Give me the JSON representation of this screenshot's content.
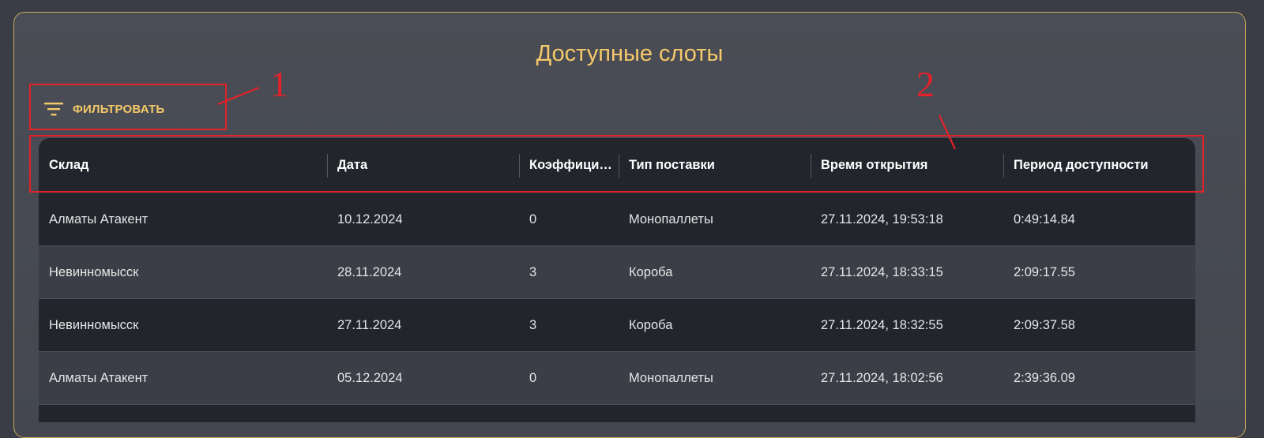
{
  "page": {
    "title": "Доступные слоты",
    "accent_color": "#f5c96a",
    "border_color": "#c9a85a"
  },
  "filter": {
    "icon": "filter-list-icon",
    "label": "ФИЛЬТРОВАТЬ"
  },
  "table": {
    "columns": [
      "Склад",
      "Дата",
      "Коэффици…",
      "Тип поставки",
      "Время открытия",
      "Период доступности"
    ],
    "rows": [
      [
        "Алматы Атакент",
        "10.12.2024",
        "0",
        "Монопаллеты",
        "27.11.2024, 19:53:18",
        "0:49:14.84"
      ],
      [
        "Невинномысск",
        "28.11.2024",
        "3",
        "Короба",
        "27.11.2024, 18:33:15",
        "2:09:17.55"
      ],
      [
        "Невинномысск",
        "27.11.2024",
        "3",
        "Короба",
        "27.11.2024, 18:32:55",
        "2:09:37.58"
      ],
      [
        "Алматы Атакент",
        "05.12.2024",
        "0",
        "Монопаллеты",
        "27.11.2024, 18:02:56",
        "2:39:36.09"
      ]
    ]
  },
  "annotations": {
    "color": "#e3222a",
    "labels": [
      "1",
      "2"
    ]
  }
}
